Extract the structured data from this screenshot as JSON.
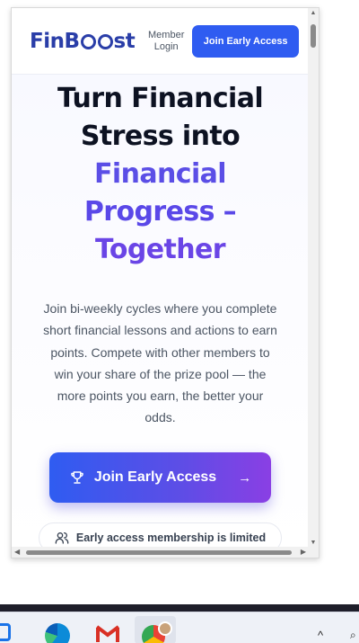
{
  "header": {
    "logo_prefix": "FinB",
    "logo_suffix": "st",
    "member_login_line1": "Member",
    "member_login_line2": "Login",
    "cta_label": "Join Early Access"
  },
  "hero": {
    "title_line1": "Turn Financial",
    "title_line2": "Stress into",
    "title_line3": "Financial",
    "title_line4": "Progress –",
    "title_line5": "Together",
    "description": "Join bi-weekly cycles where you complete short financial lessons and actions to earn points. Compete with other members to win your share of the prize pool — the more points you earn, the better your odds.",
    "cta_label": "Join Early Access",
    "cta_arrow": "→",
    "notice": "Early access membership is limited"
  },
  "colors": {
    "brand": "#2a3ea8",
    "primary_button": "#2f5cf1",
    "gradient_end": "#8a3fe4"
  },
  "taskbar": {
    "icons": [
      "windows-icon",
      "edge-icon",
      "gmail-icon",
      "chrome-icon"
    ],
    "tray_caret": "^",
    "tray_glyph": "⌕"
  }
}
